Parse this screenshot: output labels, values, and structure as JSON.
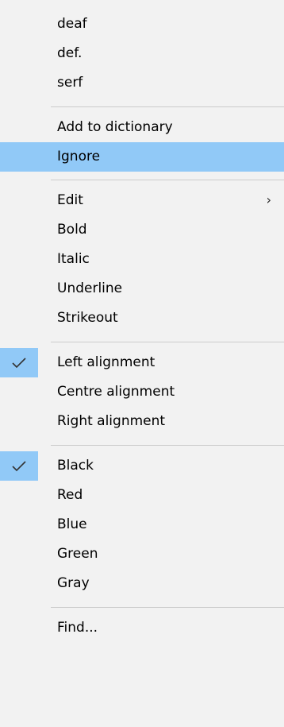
{
  "menu": {
    "suggestions": [
      "deaf",
      "def.",
      "serf"
    ],
    "add_to_dictionary": "Add to dictionary",
    "ignore": "Ignore",
    "edit": "Edit",
    "edit_arrow": "›",
    "bold": "Bold",
    "italic": "Italic",
    "underline": "Underline",
    "strikeout": "Strikeout",
    "left_alignment": "Left alignment",
    "centre_alignment": "Centre alignment",
    "right_alignment": "Right alignment",
    "black": "Black",
    "red": "Red",
    "blue": "Blue",
    "green": "Green",
    "gray": "Gray",
    "find": "Find..."
  },
  "state": {
    "highlighted_item": "Ignore",
    "checked_alignment": "Left alignment",
    "checked_color": "Black"
  },
  "colors": {
    "menu_background": "#f2f2f2",
    "highlight": "#91c9f7",
    "separator": "#cccccc"
  }
}
